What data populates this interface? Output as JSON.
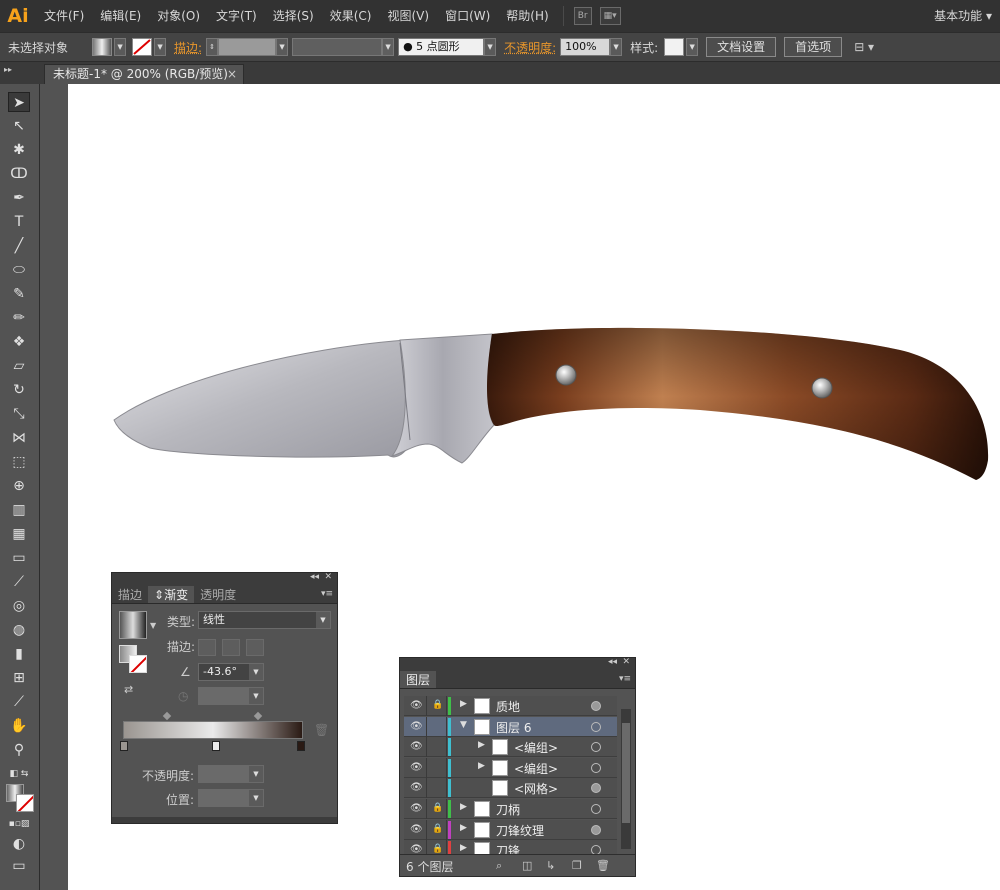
{
  "app": {
    "logo": "Ai",
    "workspace": "基本功能"
  },
  "menu": [
    "文件(F)",
    "编辑(E)",
    "对象(O)",
    "文字(T)",
    "选择(S)",
    "效果(C)",
    "视图(V)",
    "窗口(W)",
    "帮助(H)"
  ],
  "menubar_icons": {
    "bridge": "Br",
    "arrange": "▦▾"
  },
  "controlbar": {
    "selection_label": "未选择对象",
    "stroke_label": "描边:",
    "brush_value": "5 点圆形",
    "opacity_label": "不透明度:",
    "opacity_value": "100%",
    "style_label": "样式:",
    "doc_setup_button": "文档设置",
    "preferences_button": "首选项"
  },
  "document_tab": {
    "title": "未标题-1* @ 200% (RGB/预览)",
    "close": "×"
  },
  "gradient_panel": {
    "tabs": [
      "描边",
      "渐变",
      "透明度"
    ],
    "active_tab": "渐变",
    "type_label": "类型:",
    "type_value": "线性",
    "stroke_label": "描边:",
    "angle_value": "-43.6°",
    "opacity_label": "不透明度:",
    "location_label": "位置:",
    "stops": [
      "#9a9590",
      "#eaeaea",
      "#2a1a14"
    ]
  },
  "layers_panel": {
    "tab": "图层",
    "layers": [
      {
        "name": "质地",
        "color": "#3fbf4a",
        "locked": true,
        "expanded": false,
        "indent": 0,
        "selected": false,
        "target_filled": true
      },
      {
        "name": "图层 6",
        "color": "#3fbfd0",
        "locked": false,
        "expanded": true,
        "indent": 0,
        "selected": true,
        "target_filled": false
      },
      {
        "name": "<编组>",
        "color": "#3fbfd0",
        "locked": false,
        "expanded": false,
        "indent": 1,
        "selected": false,
        "target_filled": false
      },
      {
        "name": "<编组>",
        "color": "#3fbfd0",
        "locked": false,
        "expanded": false,
        "indent": 1,
        "selected": false,
        "target_filled": false
      },
      {
        "name": "<网格>",
        "color": "#3fbfd0",
        "locked": false,
        "expanded": null,
        "indent": 1,
        "selected": false,
        "target_filled": true
      },
      {
        "name": "刀柄",
        "color": "#3fbf4a",
        "locked": true,
        "expanded": false,
        "indent": 0,
        "selected": false,
        "target_filled": false
      },
      {
        "name": "刀锋纹理",
        "color": "#c040c0",
        "locked": true,
        "expanded": false,
        "indent": 0,
        "selected": false,
        "target_filled": true
      },
      {
        "name": "刀锋",
        "color": "#e04040",
        "locked": true,
        "expanded": false,
        "indent": 0,
        "selected": false,
        "target_filled": false
      }
    ],
    "count_label": "6 个图层"
  },
  "colors": {
    "handle_dark": "#3a1a0c",
    "handle_mid": "#8a4a26",
    "handle_light": "#c08050",
    "blade_light": "#e0e0e4",
    "blade_dark": "#9a9aa2",
    "accent_orange": "#e8962b"
  }
}
